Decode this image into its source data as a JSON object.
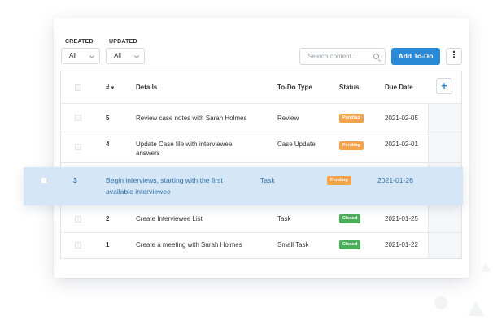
{
  "filters": {
    "created": {
      "label": "CREATED",
      "value": "All"
    },
    "updated": {
      "label": "UPDATED",
      "value": "All"
    }
  },
  "search": {
    "placeholder": "Search content..."
  },
  "actions": {
    "add_label": "Add To-Do",
    "more_label": "⋮",
    "add_column_label": "+"
  },
  "table": {
    "headers": {
      "num": "#",
      "sort_icon": "▾",
      "details": "Details",
      "type": "To-Do Type",
      "status": "Status",
      "due": "Due Date"
    },
    "rows": [
      {
        "num": "5",
        "details_line1": "Review case notes with Sarah Holmes",
        "details_line2": "",
        "type": "Review",
        "status": "Pending",
        "due": "2021-02-05"
      },
      {
        "num": "4",
        "details_line1": "Update Case file with interviewee",
        "details_line2": "answers",
        "type": "Case Update",
        "status": "Pending",
        "due": "2021-02-01"
      },
      {
        "num": "3",
        "details_line1": "Begin interviews, starting with the first",
        "details_line2": "available interviewee",
        "type": "Task",
        "status": "Pending",
        "due": "2021-01-26"
      },
      {
        "num": "2",
        "details_line1": "Create Interviewee List",
        "details_line2": "",
        "type": "Task",
        "status": "Closed",
        "due": "2021-01-25"
      },
      {
        "num": "1",
        "details_line1": "Create a meeting with Sarah Holmes",
        "details_line2": "",
        "type": "Small Task",
        "status": "Closed",
        "due": "2021-01-22"
      }
    ]
  },
  "colors": {
    "accent": "#2a8ad6",
    "pending": "#f5a34a",
    "closed": "#4cae5a",
    "highlight_bg": "#d5e7f7",
    "highlight_text": "#2f6fa8"
  }
}
